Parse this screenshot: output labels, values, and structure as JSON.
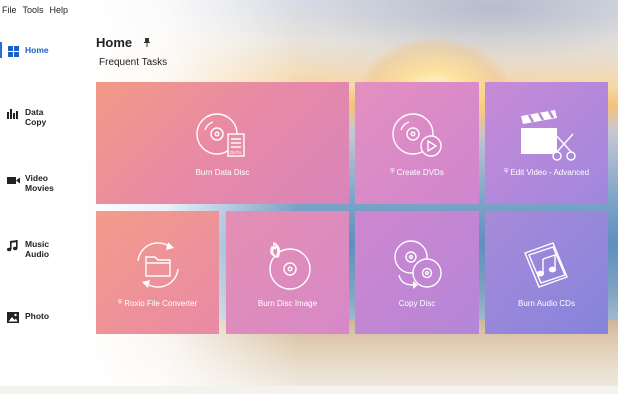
{
  "menu": {
    "items": [
      "File",
      "Tools",
      "Help"
    ]
  },
  "sidebar": {
    "items": [
      {
        "id": "home",
        "label_line1": "Home",
        "label_line2": "",
        "icon": "grid-icon",
        "active": true
      },
      {
        "id": "data-copy",
        "label_line1": "Data",
        "label_line2": "Copy",
        "icon": "bar-chart-icon",
        "active": false
      },
      {
        "id": "video-movies",
        "label_line1": "Video",
        "label_line2": "Movies",
        "icon": "video-camera-icon",
        "active": false
      },
      {
        "id": "music-audio",
        "label_line1": "Music",
        "label_line2": "Audio",
        "icon": "music-note-icon",
        "active": false
      },
      {
        "id": "photo",
        "label_line1": "Photo",
        "label_line2": "",
        "icon": "image-icon",
        "active": false
      }
    ]
  },
  "header": {
    "title": "Home",
    "pin_icon": "pin-icon",
    "subtitle": "Frequent Tasks"
  },
  "tasks": [
    {
      "id": "burn-data-disc",
      "label": "Burn Data Disc",
      "icon": "disc-document-icon",
      "shield": false
    },
    {
      "id": "create-dvds",
      "label": "Create DVDs",
      "icon": "disc-play-icon",
      "shield": true
    },
    {
      "id": "edit-video-advanced",
      "label": "Edit Video - Advanced",
      "icon": "clapperboard-scissors-icon",
      "shield": true
    },
    {
      "id": "roxio-file-converter",
      "label": "Roxio File Converter",
      "icon": "folder-convert-icon",
      "shield": true
    },
    {
      "id": "burn-disc-image",
      "label": "Burn Disc Image",
      "icon": "disc-flame-icon",
      "shield": false
    },
    {
      "id": "copy-disc",
      "label": "Copy Disc",
      "icon": "copy-disc-icon",
      "shield": false
    },
    {
      "id": "burn-audio-cds",
      "label": "Burn Audio CDs",
      "icon": "music-album-icon",
      "shield": false
    }
  ],
  "colors": {
    "accent": "#1d5fc6",
    "tile_text": "#ffffff"
  }
}
